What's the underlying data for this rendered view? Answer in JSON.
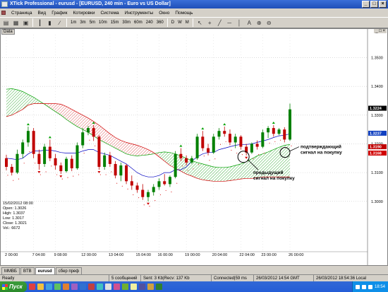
{
  "window": {
    "title": "XTick Professional - eurusd - [EURUSD, 240 min - Euro vs US Dollar]",
    "controls": [
      "_",
      "□",
      "×"
    ]
  },
  "menu": {
    "items": [
      "Страница",
      "Вид",
      "График",
      "Котировки",
      "Система",
      "Инструменты",
      "Окно",
      "Помощь"
    ]
  },
  "toolbar": {
    "timeframes": [
      "1m",
      "3m",
      "5m",
      "10m",
      "15m",
      "30m",
      "60m",
      "240",
      "360",
      "D",
      "W",
      "M"
    ]
  },
  "chart": {
    "window_label": "Data",
    "price_axis": [
      "1.3500",
      "1.3400",
      "1.3300",
      "1.3200",
      "1.3100",
      "1.3000"
    ],
    "current_price_labels": [
      "1.3224",
      "1.3237",
      "1.3190",
      "1.3168"
    ],
    "time_axis": [
      "2 00:00",
      "7 04:00",
      "9 08:00",
      "12 00:00",
      "13 04:00",
      "15 04:00",
      "16 00:00",
      "19 00:00",
      "20 04:00",
      "22 04:00",
      "23 00:00",
      "26 00:00"
    ],
    "info": {
      "date": "15/02/2012 08:00",
      "open": "Open: 1.3026",
      "high": "High: 1.3037",
      "low": "Low: 1.3017",
      "close": "Close: 1.3021",
      "vol": "Vol.: 6672"
    },
    "annotation_confirm": [
      "подтверждающий",
      "сигнал на покупку"
    ],
    "annotation_prev": [
      "предыдущий",
      "сигнал на покупку"
    ]
  },
  "tabs": [
    "ММВБ",
    "BTB",
    "eurusd",
    "сбер преф"
  ],
  "status": {
    "ready": "Ready",
    "messages": "5 сообщений",
    "traffic": "Sent: 3 Kb|Recv: 137 Kb",
    "connection": "Connected|59 ms",
    "gmt": "26/03/2012 14:54 GMT",
    "local": "26/03/2012 18:54:36 Local"
  },
  "taskbar": {
    "start_label": "Пуск",
    "clock": "18:54"
  },
  "colors": {
    "bull": "#008000",
    "bear": "#c00000",
    "kijun": "#0000c0",
    "senkou_a": "#00a000",
    "senkou_b": "#d00000"
  },
  "chart_data": {
    "type": "candlestick",
    "instrument": "EURUSD",
    "timeframe": "240 min",
    "ylim": [
      1.2965,
      1.358
    ],
    "candles": [
      {
        "o": 1.315,
        "h": 1.3162,
        "l": 1.3108,
        "c": 1.312
      },
      {
        "o": 1.312,
        "h": 1.313,
        "l": 1.309,
        "c": 1.31
      },
      {
        "o": 1.31,
        "h": 1.318,
        "l": 1.3095,
        "c": 1.3165
      },
      {
        "o": 1.3165,
        "h": 1.3215,
        "l": 1.315,
        "c": 1.3205
      },
      {
        "o": 1.3205,
        "h": 1.326,
        "l": 1.319,
        "c": 1.3245
      },
      {
        "o": 1.3245,
        "h": 1.3255,
        "l": 1.315,
        "c": 1.3165
      },
      {
        "o": 1.3165,
        "h": 1.318,
        "l": 1.311,
        "c": 1.313
      },
      {
        "o": 1.313,
        "h": 1.32,
        "l": 1.312,
        "c": 1.319
      },
      {
        "o": 1.319,
        "h": 1.3215,
        "l": 1.314,
        "c": 1.315
      },
      {
        "o": 1.315,
        "h": 1.3165,
        "l": 1.311,
        "c": 1.3125
      },
      {
        "o": 1.3125,
        "h": 1.3135,
        "l": 1.3095,
        "c": 1.3105
      },
      {
        "o": 1.3105,
        "h": 1.3155,
        "l": 1.31,
        "c": 1.3148
      },
      {
        "o": 1.3148,
        "h": 1.316,
        "l": 1.3105,
        "c": 1.3115
      },
      {
        "o": 1.3115,
        "h": 1.3205,
        "l": 1.311,
        "c": 1.3195
      },
      {
        "o": 1.3195,
        "h": 1.3255,
        "l": 1.3185,
        "c": 1.324
      },
      {
        "o": 1.324,
        "h": 1.3262,
        "l": 1.323,
        "c": 1.3255
      },
      {
        "o": 1.3255,
        "h": 1.3265,
        "l": 1.321,
        "c": 1.3225
      },
      {
        "o": 1.3225,
        "h": 1.323,
        "l": 1.311,
        "c": 1.312
      },
      {
        "o": 1.312,
        "h": 1.317,
        "l": 1.311,
        "c": 1.316
      },
      {
        "o": 1.316,
        "h": 1.3172,
        "l": 1.312,
        "c": 1.313
      },
      {
        "o": 1.313,
        "h": 1.314,
        "l": 1.308,
        "c": 1.309
      },
      {
        "o": 1.309,
        "h": 1.3135,
        "l": 1.307,
        "c": 1.3125
      },
      {
        "o": 1.3125,
        "h": 1.313,
        "l": 1.306,
        "c": 1.307
      },
      {
        "o": 1.307,
        "h": 1.309,
        "l": 1.304,
        "c": 1.3055
      },
      {
        "o": 1.3055,
        "h": 1.3065,
        "l": 1.303,
        "c": 1.304
      },
      {
        "o": 1.304,
        "h": 1.306,
        "l": 1.3005,
        "c": 1.3015
      },
      {
        "o": 1.3015,
        "h": 1.304,
        "l": 1.3,
        "c": 1.3032
      },
      {
        "o": 1.3032,
        "h": 1.306,
        "l": 1.302,
        "c": 1.305
      },
      {
        "o": 1.305,
        "h": 1.308,
        "l": 1.304,
        "c": 1.307
      },
      {
        "o": 1.307,
        "h": 1.3095,
        "l": 1.3055,
        "c": 1.306
      },
      {
        "o": 1.306,
        "h": 1.309,
        "l": 1.305,
        "c": 1.3085
      },
      {
        "o": 1.3085,
        "h": 1.3175,
        "l": 1.308,
        "c": 1.3165
      },
      {
        "o": 1.3165,
        "h": 1.3185,
        "l": 1.314,
        "c": 1.315
      },
      {
        "o": 1.315,
        "h": 1.316,
        "l": 1.3125,
        "c": 1.3135
      },
      {
        "o": 1.3135,
        "h": 1.3158,
        "l": 1.313,
        "c": 1.315
      },
      {
        "o": 1.315,
        "h": 1.3235,
        "l": 1.3145,
        "c": 1.3225
      },
      {
        "o": 1.3225,
        "h": 1.3245,
        "l": 1.3175,
        "c": 1.3185
      },
      {
        "o": 1.3185,
        "h": 1.32,
        "l": 1.316,
        "c": 1.317
      },
      {
        "o": 1.317,
        "h": 1.3235,
        "l": 1.3165,
        "c": 1.3225
      },
      {
        "o": 1.3225,
        "h": 1.3255,
        "l": 1.3215,
        "c": 1.3245
      },
      {
        "o": 1.3245,
        "h": 1.326,
        "l": 1.3225,
        "c": 1.3235
      },
      {
        "o": 1.3235,
        "h": 1.325,
        "l": 1.3195,
        "c": 1.3205
      },
      {
        "o": 1.3205,
        "h": 1.3235,
        "l": 1.3185,
        "c": 1.3225
      },
      {
        "o": 1.3225,
        "h": 1.323,
        "l": 1.318,
        "c": 1.319
      },
      {
        "o": 1.319,
        "h": 1.32,
        "l": 1.316,
        "c": 1.317
      },
      {
        "o": 1.317,
        "h": 1.3205,
        "l": 1.3165,
        "c": 1.32
      },
      {
        "o": 1.32,
        "h": 1.3212,
        "l": 1.318,
        "c": 1.319
      },
      {
        "o": 1.319,
        "h": 1.325,
        "l": 1.3185,
        "c": 1.324
      },
      {
        "o": 1.324,
        "h": 1.3262,
        "l": 1.322,
        "c": 1.3255
      },
      {
        "o": 1.3255,
        "h": 1.3265,
        "l": 1.3225,
        "c": 1.3235
      },
      {
        "o": 1.3235,
        "h": 1.3255,
        "l": 1.323,
        "c": 1.325
      },
      {
        "o": 1.325,
        "h": 1.3258,
        "l": 1.3205,
        "c": 1.3215
      },
      {
        "o": 1.3215,
        "h": 1.334,
        "l": 1.321,
        "c": 1.332
      }
    ],
    "kijun": [
      1.315,
      1.3148,
      1.3145,
      1.315,
      1.3165,
      1.3175,
      1.3175,
      1.3178,
      1.3178,
      1.3175,
      1.317,
      1.3168,
      1.3168,
      1.3168,
      1.3175,
      1.318,
      1.318,
      1.317,
      1.3165,
      1.316,
      1.315,
      1.314,
      1.313,
      1.3115,
      1.31,
      1.309,
      1.3085,
      1.3085,
      1.309,
      1.31,
      1.31,
      1.311,
      1.311,
      1.312,
      1.314,
      1.3155,
      1.3165,
      1.317,
      1.317,
      1.318,
      1.3185,
      1.319,
      1.3195,
      1.3198,
      1.3198,
      1.32,
      1.3205,
      1.321,
      1.3215,
      1.3222,
      1.3228,
      1.323,
      1.3235
    ],
    "senkou_a": [
      1.339,
      1.3392,
      1.3388,
      1.3382,
      1.3372,
      1.3362,
      1.335,
      1.3338,
      1.3325,
      1.3312,
      1.33,
      1.3285,
      1.3272,
      1.326,
      1.325,
      1.324,
      1.3228,
      1.3215,
      1.3205,
      1.3195,
      1.3185,
      1.3175,
      1.3165,
      1.316,
      1.3158,
      1.316,
      1.3162,
      1.3165,
      1.317,
      1.3172,
      1.317,
      1.3165,
      1.3158,
      1.315,
      1.3142,
      1.3135,
      1.313,
      1.3125,
      1.312,
      1.3118,
      1.3118,
      1.312,
      1.3125,
      1.313,
      1.3138,
      1.3148,
      1.3158,
      1.3165,
      1.3172,
      1.318,
      1.3188,
      1.3195,
      1.3198
    ],
    "senkou_b": [
      1.3295,
      1.33,
      1.331,
      1.332,
      1.3335,
      1.334,
      1.334,
      1.334,
      1.334,
      1.334,
      1.3338,
      1.333,
      1.332,
      1.331,
      1.33,
      1.329,
      1.3278,
      1.3265,
      1.325,
      1.3235,
      1.3222,
      1.3212,
      1.3205,
      1.32,
      1.3195,
      1.3188,
      1.318,
      1.317,
      1.3155,
      1.314,
      1.3125,
      1.3115,
      1.3105,
      1.3095,
      1.3088,
      1.308,
      1.3075,
      1.3072,
      1.307,
      1.307,
      1.307,
      1.3072,
      1.3075,
      1.3078,
      1.308,
      1.308,
      1.3082,
      1.3085,
      1.3085,
      1.3085,
      1.3085,
      1.3085,
      1.3085
    ]
  }
}
